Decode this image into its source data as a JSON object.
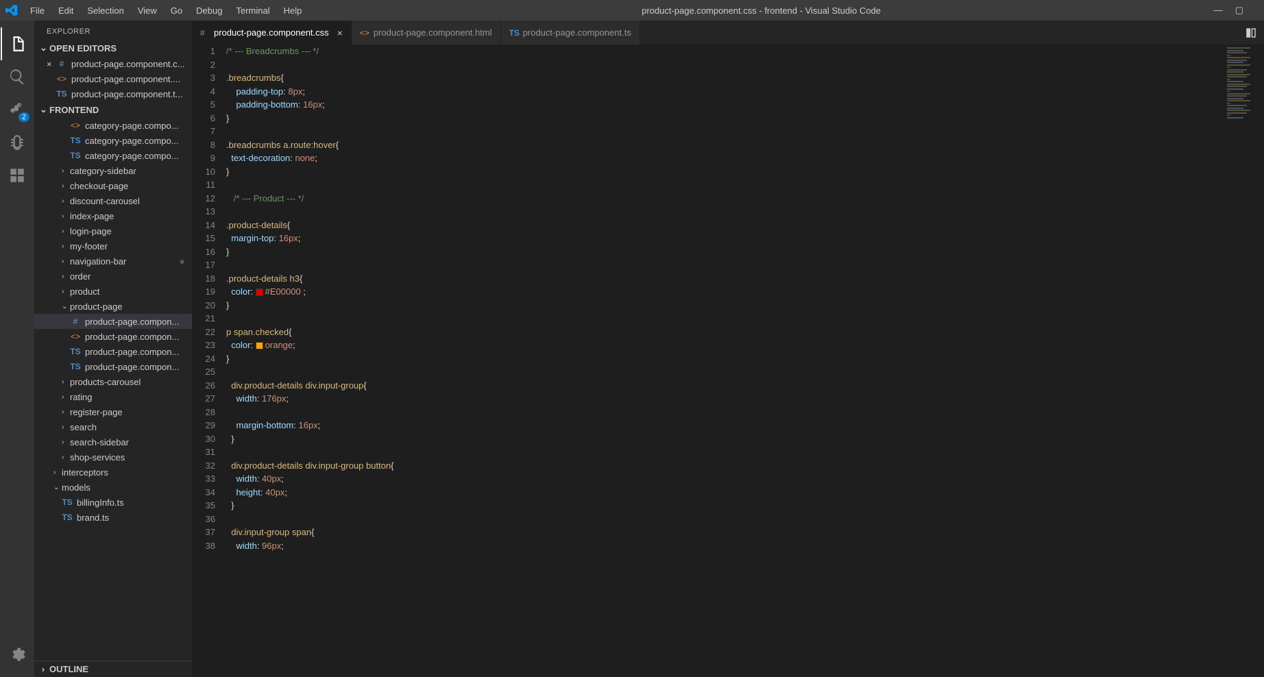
{
  "titlebar": {
    "menu": [
      "File",
      "Edit",
      "Selection",
      "View",
      "Go",
      "Debug",
      "Terminal",
      "Help"
    ],
    "title": "product-page.component.css - frontend - Visual Studio Code"
  },
  "activitybar": {
    "scm_badge": "2"
  },
  "sidebar": {
    "title": "EXPLORER",
    "open_editors_label": "OPEN EDITORS",
    "open_editors": [
      {
        "icon": "#",
        "iconClass": "ficon-css",
        "label": "product-page.component.c...",
        "close": true
      },
      {
        "icon": "<>",
        "iconClass": "ficon-html",
        "label": "product-page.component...."
      },
      {
        "icon": "TS",
        "iconClass": "ficon-ts",
        "label": "product-page.component.t..."
      }
    ],
    "project_label": "FRONTEND",
    "tree": [
      {
        "depth": 2,
        "icon": "<>",
        "iconClass": "ficon-html",
        "label": "category-page.compo..."
      },
      {
        "depth": 2,
        "icon": "TS",
        "iconClass": "ficon-ts",
        "label": "category-page.compo..."
      },
      {
        "depth": 2,
        "icon": "TS",
        "iconClass": "ficon-ts",
        "label": "category-page.compo..."
      },
      {
        "depth": 1,
        "chev": "›",
        "label": "category-sidebar"
      },
      {
        "depth": 1,
        "chev": "›",
        "label": "checkout-page"
      },
      {
        "depth": 1,
        "chev": "›",
        "label": "discount-carousel"
      },
      {
        "depth": 1,
        "chev": "›",
        "label": "index-page"
      },
      {
        "depth": 1,
        "chev": "›",
        "label": "login-page"
      },
      {
        "depth": 1,
        "chev": "›",
        "label": "my-footer"
      },
      {
        "depth": 1,
        "chev": "›",
        "label": "navigation-bar",
        "dot": true
      },
      {
        "depth": 1,
        "chev": "›",
        "label": "order"
      },
      {
        "depth": 1,
        "chev": "›",
        "label": "product"
      },
      {
        "depth": 1,
        "chev": "⌄",
        "label": "product-page"
      },
      {
        "depth": 2,
        "icon": "#",
        "iconClass": "ficon-css",
        "label": "product-page.compon...",
        "selected": true
      },
      {
        "depth": 2,
        "icon": "<>",
        "iconClass": "ficon-html",
        "label": "product-page.compon..."
      },
      {
        "depth": 2,
        "icon": "TS",
        "iconClass": "ficon-ts",
        "label": "product-page.compon..."
      },
      {
        "depth": 2,
        "icon": "TS",
        "iconClass": "ficon-ts",
        "label": "product-page.compon..."
      },
      {
        "depth": 1,
        "chev": "›",
        "label": "products-carousel"
      },
      {
        "depth": 1,
        "chev": "›",
        "label": "rating"
      },
      {
        "depth": 1,
        "chev": "›",
        "label": "register-page"
      },
      {
        "depth": 1,
        "chev": "›",
        "label": "search"
      },
      {
        "depth": 1,
        "chev": "›",
        "label": "search-sidebar"
      },
      {
        "depth": 1,
        "chev": "›",
        "label": "shop-services"
      },
      {
        "depth": 0,
        "chev": "›",
        "label": "interceptors"
      },
      {
        "depth": 0,
        "chev": "⌄",
        "label": "models"
      },
      {
        "depth": 1,
        "icon": "TS",
        "iconClass": "ficon-ts",
        "label": "billingInfo.ts"
      },
      {
        "depth": 1,
        "icon": "TS",
        "iconClass": "ficon-ts",
        "label": "brand.ts"
      }
    ],
    "outline_label": "OUTLINE"
  },
  "tabs": [
    {
      "icon": "#",
      "iconClass": "ficon-css",
      "label": "product-page.component.css",
      "active": true,
      "close": true
    },
    {
      "icon": "<>",
      "iconClass": "ficon-html",
      "label": "product-page.component.html"
    },
    {
      "icon": "TS",
      "iconClass": "ficon-ts",
      "label": "product-page.component.ts"
    }
  ],
  "code": {
    "lines": [
      [
        {
          "t": "comment",
          "v": "/* --- Breadcrumbs --- */"
        }
      ],
      [],
      [
        {
          "t": "selector",
          "v": ".breadcrumbs"
        },
        {
          "t": "brace",
          "v": "{"
        }
      ],
      [
        {
          "t": "indent",
          "v": "    "
        },
        {
          "t": "prop",
          "v": "padding-top"
        },
        {
          "t": "punc",
          "v": ": "
        },
        {
          "t": "val",
          "v": "8px"
        },
        {
          "t": "punc",
          "v": ";"
        }
      ],
      [
        {
          "t": "indent",
          "v": "    "
        },
        {
          "t": "prop",
          "v": "padding-bottom"
        },
        {
          "t": "punc",
          "v": ": "
        },
        {
          "t": "val",
          "v": "16px"
        },
        {
          "t": "punc",
          "v": ";"
        }
      ],
      [
        {
          "t": "brace",
          "v": "}"
        }
      ],
      [],
      [
        {
          "t": "selector",
          "v": ".breadcrumbs a.route:hover"
        },
        {
          "t": "brace",
          "v": "{"
        }
      ],
      [
        {
          "t": "indent",
          "v": "  "
        },
        {
          "t": "prop",
          "v": "text-decoration"
        },
        {
          "t": "punc",
          "v": ": "
        },
        {
          "t": "val",
          "v": "none"
        },
        {
          "t": "punc",
          "v": ";"
        }
      ],
      [
        {
          "t": "brace",
          "v": "}"
        }
      ],
      [],
      [
        {
          "t": "indent",
          "v": "   "
        },
        {
          "t": "comment",
          "v": "/* --- Product --- */"
        }
      ],
      [],
      [
        {
          "t": "selector",
          "v": ".product-details"
        },
        {
          "t": "brace",
          "v": "{"
        }
      ],
      [
        {
          "t": "indent",
          "v": "  "
        },
        {
          "t": "prop",
          "v": "margin-top"
        },
        {
          "t": "punc",
          "v": ": "
        },
        {
          "t": "val",
          "v": "16px"
        },
        {
          "t": "punc",
          "v": ";"
        }
      ],
      [
        {
          "t": "brace",
          "v": "}"
        }
      ],
      [],
      [
        {
          "t": "selector",
          "v": ".product-details h3"
        },
        {
          "t": "brace",
          "v": "{"
        }
      ],
      [
        {
          "t": "indent",
          "v": "  "
        },
        {
          "t": "prop",
          "v": "color"
        },
        {
          "t": "punc",
          "v": ": "
        },
        {
          "t": "swatch",
          "v": "#E00000"
        },
        {
          "t": "val",
          "v": "#E00000 "
        },
        {
          "t": "punc",
          "v": ";"
        }
      ],
      [
        {
          "t": "brace",
          "v": "}"
        }
      ],
      [],
      [
        {
          "t": "selector",
          "v": "p span.checked"
        },
        {
          "t": "brace",
          "v": "{"
        }
      ],
      [
        {
          "t": "indent",
          "v": "  "
        },
        {
          "t": "prop",
          "v": "color"
        },
        {
          "t": "punc",
          "v": ": "
        },
        {
          "t": "swatch",
          "v": "orange"
        },
        {
          "t": "val",
          "v": "orange"
        },
        {
          "t": "punc",
          "v": ";"
        }
      ],
      [
        {
          "t": "brace",
          "v": "}"
        }
      ],
      [],
      [
        {
          "t": "indent",
          "v": "  "
        },
        {
          "t": "selector",
          "v": "div.product-details div.input-group"
        },
        {
          "t": "brace",
          "v": "{"
        }
      ],
      [
        {
          "t": "indent",
          "v": "    "
        },
        {
          "t": "prop",
          "v": "width"
        },
        {
          "t": "punc",
          "v": ": "
        },
        {
          "t": "val",
          "v": "176px"
        },
        {
          "t": "punc",
          "v": ";"
        }
      ],
      [],
      [
        {
          "t": "indent",
          "v": "    "
        },
        {
          "t": "prop",
          "v": "margin-bottom"
        },
        {
          "t": "punc",
          "v": ": "
        },
        {
          "t": "val",
          "v": "16px"
        },
        {
          "t": "punc",
          "v": ";"
        }
      ],
      [
        {
          "t": "indent",
          "v": "  "
        },
        {
          "t": "brace",
          "v": "}"
        }
      ],
      [],
      [
        {
          "t": "indent",
          "v": "  "
        },
        {
          "t": "selector",
          "v": "div.product-details div.input-group button"
        },
        {
          "t": "brace",
          "v": "{"
        }
      ],
      [
        {
          "t": "indent",
          "v": "    "
        },
        {
          "t": "prop",
          "v": "width"
        },
        {
          "t": "punc",
          "v": ": "
        },
        {
          "t": "val",
          "v": "40px"
        },
        {
          "t": "punc",
          "v": ";"
        }
      ],
      [
        {
          "t": "indent",
          "v": "    "
        },
        {
          "t": "prop",
          "v": "height"
        },
        {
          "t": "punc",
          "v": ": "
        },
        {
          "t": "val",
          "v": "40px"
        },
        {
          "t": "punc",
          "v": ";"
        }
      ],
      [
        {
          "t": "indent",
          "v": "  "
        },
        {
          "t": "brace",
          "v": "}"
        }
      ],
      [],
      [
        {
          "t": "indent",
          "v": "  "
        },
        {
          "t": "selector",
          "v": "div.input-group span"
        },
        {
          "t": "brace",
          "v": "{"
        }
      ],
      [
        {
          "t": "indent",
          "v": "    "
        },
        {
          "t": "prop",
          "v": "width"
        },
        {
          "t": "punc",
          "v": ": "
        },
        {
          "t": "val",
          "v": "96px"
        },
        {
          "t": "punc",
          "v": ";"
        }
      ]
    ]
  }
}
